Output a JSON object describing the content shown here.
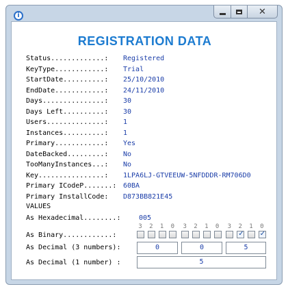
{
  "window": {
    "close_glyph": "✕"
  },
  "heading": "REGISTRATION DATA",
  "fields": [
    {
      "label": "Status.............:",
      "value": "Registered"
    },
    {
      "label": "KeyType............:",
      "value": "Trial"
    },
    {
      "label": "StartDate..........:",
      "value": "25/10/2010"
    },
    {
      "label": "EndDate............:",
      "value": "24/11/2010"
    },
    {
      "label": "Days...............:",
      "value": "30"
    },
    {
      "label": "Days Left..........:",
      "value": "30"
    },
    {
      "label": "Users..............:",
      "value": "1"
    },
    {
      "label": "Instances..........:",
      "value": "1"
    },
    {
      "label": "Primary............:",
      "value": "Yes"
    },
    {
      "label": "DateBacked.........:",
      "value": "No"
    },
    {
      "label": "TooManyInstances...:",
      "value": "No"
    },
    {
      "label": "Key................:",
      "value": "1LPA6LJ-GTVEEUW-5NFDDDR-RM706D0"
    },
    {
      "label": "Primary ICodeP.......:",
      "value": "60BA"
    },
    {
      "label": "Primary InstallCode:",
      "value": "D873BB821E45"
    }
  ],
  "values_heading": "VALUES",
  "hex": {
    "label": "As Hexadecimal........:",
    "value": "005"
  },
  "binary": {
    "label": "As Binary............:",
    "bit_labels": [
      "3",
      "2",
      "1",
      "0",
      "3",
      "2",
      "1",
      "0",
      "3",
      "2",
      "1",
      "0"
    ],
    "bits": [
      false,
      false,
      false,
      false,
      false,
      false,
      false,
      false,
      false,
      true,
      false,
      true
    ]
  },
  "decimal3": {
    "label": "As Decimal (3 numbers):",
    "values": [
      "0",
      "0",
      "5"
    ]
  },
  "decimal1": {
    "label": "As Decimal (1 number) :",
    "value": "5"
  }
}
